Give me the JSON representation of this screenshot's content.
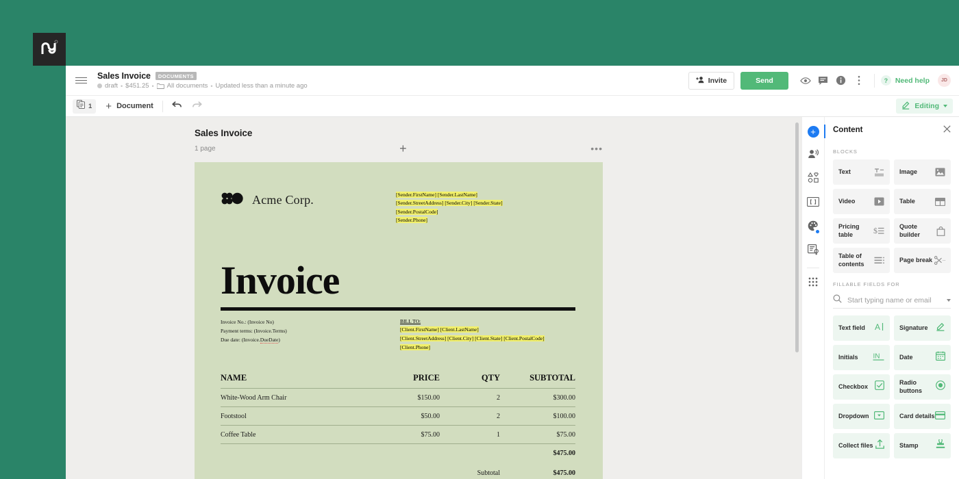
{
  "brand": {
    "logo_icon": "pandadoc-logo",
    "background_color": "#2a8468"
  },
  "header": {
    "menu_icon": "hamburger-menu-icon",
    "doc_title": "Sales Invoice",
    "doc_badge": "DOCUMENTS",
    "status": "draft",
    "amount": "$451.25",
    "folder": "All documents",
    "updated": "Updated less than a minute ago",
    "invite_label": "Invite",
    "send_label": "Send",
    "need_help_label": "Need help",
    "help_glyph": "?",
    "avatar_initials": "JD",
    "icons": [
      "eye-icon",
      "comment-icon",
      "info-icon",
      "more-vertical-icon"
    ]
  },
  "toolbar": {
    "page_count": "1",
    "add_document_label": "Document",
    "undo_icon": "undo-icon",
    "redo_icon": "redo-icon",
    "mode_label": "Editing"
  },
  "canvas": {
    "doc_name": "Sales Invoice",
    "page_count_label": "1 page",
    "add_glyph": "+",
    "more_glyph": "•••"
  },
  "invoice": {
    "company_name": "Acme Corp.",
    "sender": [
      "[Sender.FirstName] [Sender.LastName]",
      "[Sender.StreetAddress] [Sender.City] [Sender.State]",
      "[Sender.PostalCode]",
      "[Sender.Phone]"
    ],
    "heading": "Invoice",
    "meta": {
      "invoice_no": "Invoice No.: (Invoice No)",
      "payment_terms": "Payment terms: (Invoice.Terms)",
      "due_date_prefix": "Due date: (Invoice.",
      "due_date_token": "DueDate",
      "due_date_suffix": ")"
    },
    "bill_to_label": "BILL TO:",
    "client": [
      "[Client.FirstName] [Client.LastName]",
      "[Client.StreetAddress] [Client.City] [Client.State] [Client.PostalCode]",
      "[Client.Phone]"
    ],
    "table": {
      "headers": [
        "NAME",
        "PRICE",
        "QTY",
        "SUBTOTAL"
      ],
      "rows": [
        {
          "name": "White-Wood Arm Chair",
          "price": "$150.00",
          "qty": "2",
          "subtotal": "$300.00"
        },
        {
          "name": "Footstool",
          "price": "$50.00",
          "qty": "2",
          "subtotal": "$100.00"
        },
        {
          "name": "Coffee Table",
          "price": "$75.00",
          "qty": "1",
          "subtotal": "$75.00"
        }
      ],
      "total_value": "$475.00",
      "subtotal_label": "Subtotal",
      "subtotal_value": "$475.00"
    },
    "page_color": "#d2ddbf",
    "merge_field_highlight": "#f2f06a"
  },
  "rail": {
    "items": [
      "add-block-icon",
      "recipients-icon",
      "shapes-icon",
      "variables-icon",
      "theme-palette-icon",
      "workflow-icon",
      "apps-grid-icon"
    ]
  },
  "panel": {
    "title": "Content",
    "close_icon": "close-icon",
    "blocks_label": "BLOCKS",
    "blocks": [
      {
        "label": "Text",
        "icon": "text-block-icon"
      },
      {
        "label": "Image",
        "icon": "image-block-icon"
      },
      {
        "label": "Video",
        "icon": "video-block-icon"
      },
      {
        "label": "Table",
        "icon": "table-block-icon"
      },
      {
        "label": "Pricing table",
        "icon": "pricing-table-icon"
      },
      {
        "label": "Quote builder",
        "icon": "quote-builder-icon"
      },
      {
        "label": "Table of contents",
        "icon": "table-of-contents-icon"
      },
      {
        "label": "Page break",
        "icon": "page-break-icon"
      }
    ],
    "fields_label": "FILLABLE FIELDS FOR",
    "search_placeholder": "Start typing name or email",
    "search_value": "",
    "search_icon": "search-icon",
    "fields": [
      {
        "label": "Text field",
        "icon": "text-field-icon"
      },
      {
        "label": "Signature",
        "icon": "signature-icon"
      },
      {
        "label": "Initials",
        "icon": "initials-icon"
      },
      {
        "label": "Date",
        "icon": "date-icon"
      },
      {
        "label": "Checkbox",
        "icon": "checkbox-icon"
      },
      {
        "label": "Radio buttons",
        "icon": "radio-buttons-icon"
      },
      {
        "label": "Dropdown",
        "icon": "dropdown-icon"
      },
      {
        "label": "Card details",
        "icon": "card-details-icon"
      },
      {
        "label": "Collect files",
        "icon": "collect-files-icon"
      },
      {
        "label": "Stamp",
        "icon": "stamp-icon"
      }
    ],
    "accent_color": "#52b978"
  }
}
